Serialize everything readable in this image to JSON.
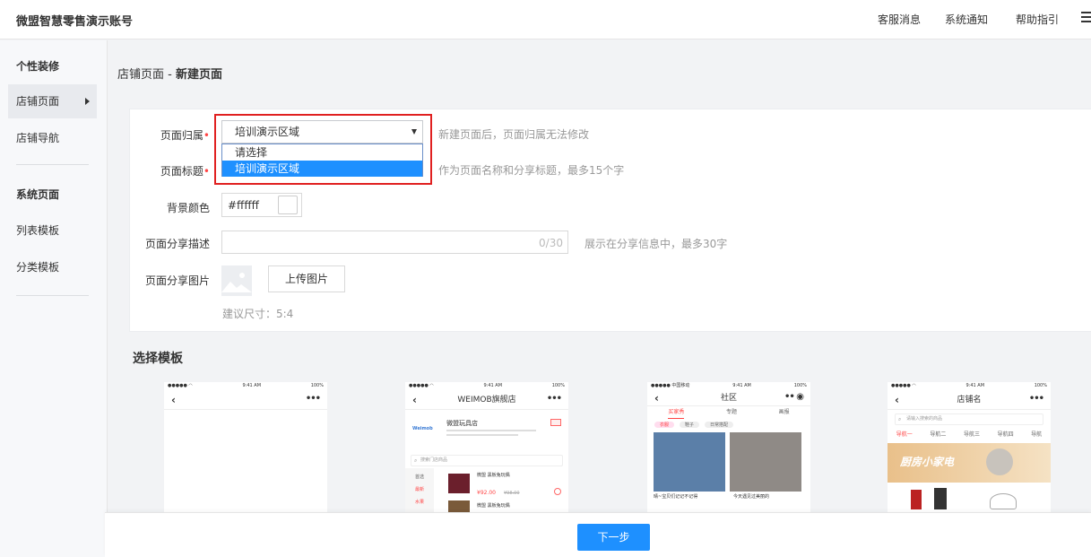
{
  "app": {
    "title": "微盟智慧零售演示账号"
  },
  "topnav": {
    "customer_msg": "客服消息",
    "system_notice": "系统通知",
    "help": "帮助指引"
  },
  "sidebar": {
    "group1": "个性装修",
    "item_store_page": "店铺页面",
    "item_store_nav": "店铺导航",
    "group2": "系统页面",
    "item_list_tpl": "列表模板",
    "item_category_tpl": "分类模板"
  },
  "breadcrumb": {
    "parent": "店铺页面 -",
    "current": "新建页面"
  },
  "form": {
    "belong_label": "页面归属",
    "belong_value": "培训演示区域",
    "belong_options": [
      "请选择",
      "培训演示区域"
    ],
    "belong_hint": "新建页面后，页面归属无法修改",
    "title_label": "页面标题",
    "title_hint": "作为页面名称和分享标题，最多15个字",
    "bg_label": "背景颜色",
    "bg_value": "#ffffff",
    "desc_label": "页面分享描述",
    "desc_count": "0/30",
    "desc_hint": "展示在分享信息中，最多30字",
    "img_label": "页面分享图片",
    "upload_label": "上传图片",
    "size_hint": "建议尺寸：5:4"
  },
  "templates": {
    "title": "选择模板",
    "t1": {
      "time": "9:41 AM",
      "battery": "100%"
    },
    "t2": {
      "time": "9:41 AM",
      "battery": "100%",
      "store": "WEIMOB旗舰店",
      "shop_name": "微盟玩具店",
      "search": "搜索门店商品",
      "cat1": "首选",
      "cat2": "最新",
      "cat3": "水果",
      "item": "微盟 黑板兔玩偶",
      "price": "¥92.00",
      "old_price": "¥98.00"
    },
    "t3": {
      "carrier": "中国移动",
      "time": "9:41 AM",
      "battery": "100%",
      "title": "社区",
      "tab1": "买家秀",
      "tab2": "专题",
      "tab3": "画报",
      "tag1": "衣服",
      "tag2": "鞋子",
      "tag3": "日常搭配",
      "cap1": "晴~宝贝们记记不记得",
      "cap2": "今天遇见过美丽的"
    },
    "t4": {
      "time": "9:41 AM",
      "battery": "100%",
      "title": "店铺名",
      "search": "请输入搜索的商品",
      "nav1": "导航一",
      "nav2": "导航二",
      "nav3": "导航三",
      "nav4": "导航四",
      "nav5": "导航",
      "banner": "厨房小家电"
    }
  },
  "footer": {
    "next_label": "下一步"
  },
  "colors": {
    "accent": "#1e90ff",
    "highlight": "#e02020"
  }
}
